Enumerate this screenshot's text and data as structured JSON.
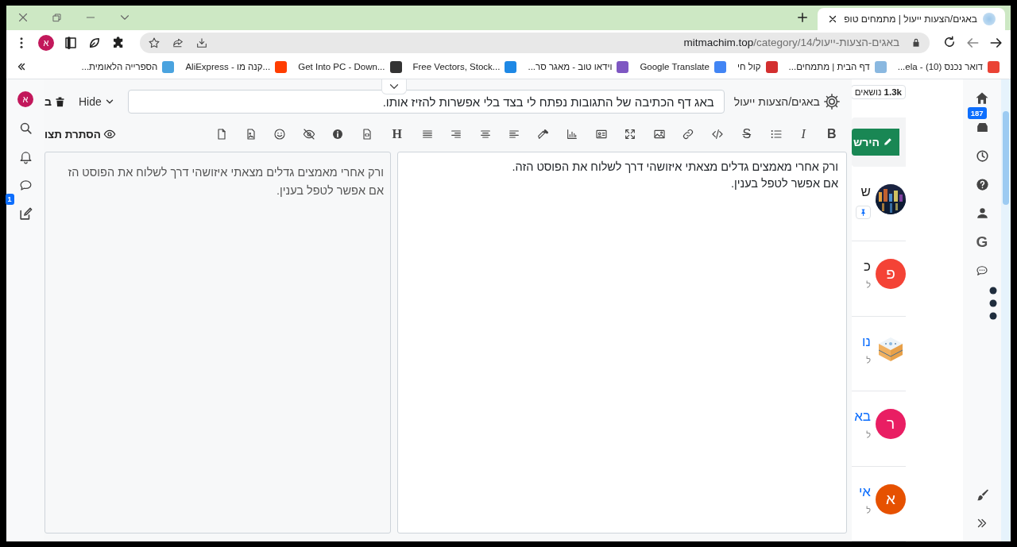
{
  "tab": {
    "title": "באגים/הצעות ייעול | מתמחים טופ",
    "selected": true
  },
  "address_bar": {
    "host": "mitmachim.top",
    "path": "/category/14/באגים-הצעות-ייעול"
  },
  "profile": {
    "initial": "א"
  },
  "bookmarks": [
    {
      "label": "דואר נכנס (10) - ela..."
    },
    {
      "label": "דף הבית | מתמחים..."
    },
    {
      "label": "קול חי"
    },
    {
      "label": "Google Translate"
    },
    {
      "label": "וידאו טוב - מאגר סר..."
    },
    {
      "label": "Free Vectors, Stock..."
    },
    {
      "label": "Get Into PC - Down..."
    },
    {
      "label": "AliExpress - קנה מו..."
    },
    {
      "label": "הספרייה הלאומית..."
    }
  ],
  "left_rail": {
    "avatar": "א",
    "drafts_badge": "1"
  },
  "composer": {
    "discard_label": "ב",
    "hide_label": "Hide",
    "title": "באג דף הכתיבה של התגובות נפתח לי בצד בלי אפשרות להזיז אותו.",
    "category": "באגים/הצעות ייעול",
    "toolbar": [
      {
        "kind": "bold",
        "label": "B"
      },
      {
        "kind": "italic",
        "label": "I"
      },
      {
        "kind": "icon"
      },
      {
        "kind": "strike",
        "label": "S"
      },
      {
        "kind": "icon"
      },
      {
        "kind": "icon"
      },
      {
        "kind": "icon"
      },
      {
        "kind": "icon"
      },
      {
        "kind": "icon"
      },
      {
        "kind": "icon"
      },
      {
        "kind": "icon"
      },
      {
        "kind": "icon"
      },
      {
        "kind": "icon"
      },
      {
        "kind": "icon"
      },
      {
        "kind": "icon"
      },
      {
        "kind": "heading",
        "label": "H"
      },
      {
        "kind": "icon"
      },
      {
        "kind": "icon"
      },
      {
        "kind": "icon"
      },
      {
        "kind": "icon"
      },
      {
        "kind": "icon"
      },
      {
        "kind": "icon"
      }
    ],
    "preview_toggle": "הסתרת תצו",
    "editor_lines": [
      "ורק אחרי מאמצים גדלים מצאתי איזושהי דרך לשלוח את הפוסט הזה.",
      "אם אפשר לטפל בענין."
    ],
    "preview_lines": [
      "ורק אחרי מאמצים גדלים מצאתי איזושהי דרך לשלוח את הפוסט הז",
      "אם אפשר לטפל בענין."
    ]
  },
  "category_page": {
    "topic_count": "**1.3k** נושאים",
    "watch_button": "הירש",
    "topics": [
      {
        "kind": "picture",
        "title": "ש",
        "visited": false,
        "pinned": true
      },
      {
        "kind": "letter",
        "avatar_letter": "פ",
        "color": "#f44336",
        "title": "כ",
        "subtitle": "ל",
        "visited": false,
        "pinned": false
      },
      {
        "kind": "picture",
        "title": "נו",
        "subtitle": "ל",
        "visited": true,
        "pinned": false
      },
      {
        "kind": "letter",
        "avatar_letter": "ר",
        "color": "#e91e63",
        "title": "בא",
        "subtitle": "ל",
        "visited": true,
        "pinned": false
      },
      {
        "kind": "letter",
        "avatar_letter": "א",
        "color": "#e65100",
        "title": "אי",
        "subtitle": "ל",
        "visited": true,
        "pinned": false
      }
    ]
  },
  "right_rail": {
    "inbox_badge": "187",
    "letter_item": "G"
  }
}
